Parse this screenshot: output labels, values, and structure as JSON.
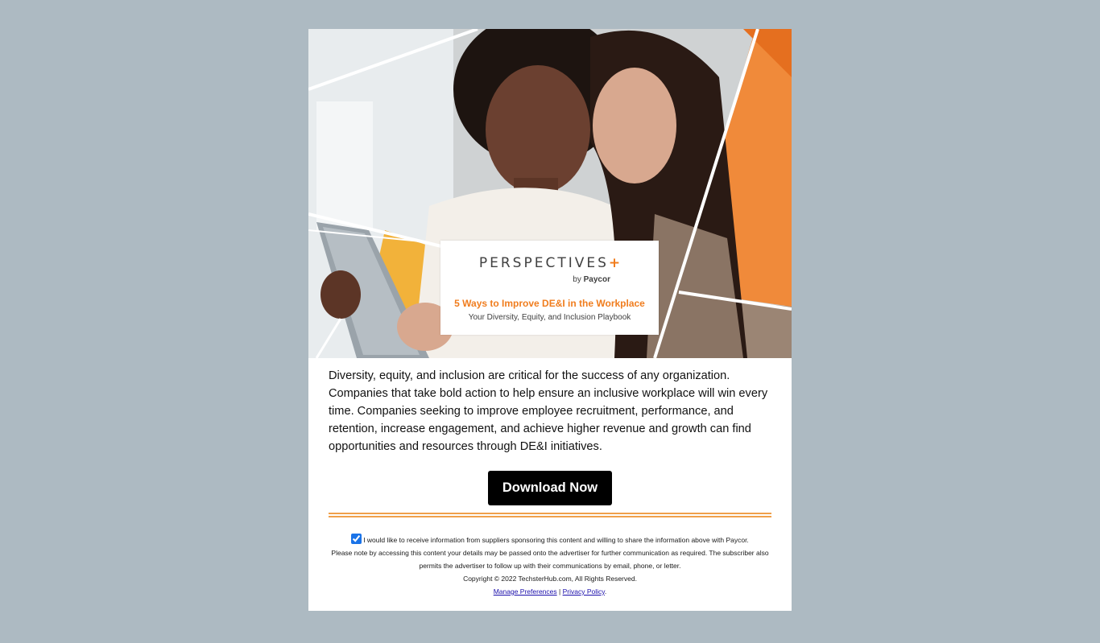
{
  "hero": {
    "book_brand_main": "PERSPECTIVES",
    "book_brand_plus": "+",
    "book_byline_by": "by",
    "book_byline_company": "Paycor",
    "book_title": "5 Ways to Improve DE&I in the Workplace",
    "book_subtitle": "Your Diversity, Equity, and Inclusion Playbook"
  },
  "body": {
    "paragraph": "Diversity, equity, and inclusion are critical for the success of any organization. Companies that take bold action to help ensure an inclusive workplace will win every time. Companies seeking to improve employee recruitment, performance, and retention, increase engagement, and achieve higher revenue and growth can find opportunities and resources through DE&I initiatives."
  },
  "cta": {
    "label": "Download Now"
  },
  "footer": {
    "consent_checked": true,
    "consent_text": "I would like to receive information from suppliers sponsoring this content and willing to share the information above with Paycor.",
    "notice_line1": "Please note by accessing this content your details may be passed onto the advertiser for further communication as required. The subscriber also",
    "notice_line2": "permits the advertiser to follow up with their communications by email, phone, or letter.",
    "copyright": "Copyright © 2022 TechsterHub.com, All Rights Reserved.",
    "manage_link": "Manage Preferences",
    "separator": "|",
    "privacy_link": "Privacy Policy",
    "trailing": "."
  },
  "colors": {
    "page_background": "#adbac2",
    "accent_orange": "#f07d1e",
    "divider": "#f0a04a",
    "button": "#000000"
  }
}
